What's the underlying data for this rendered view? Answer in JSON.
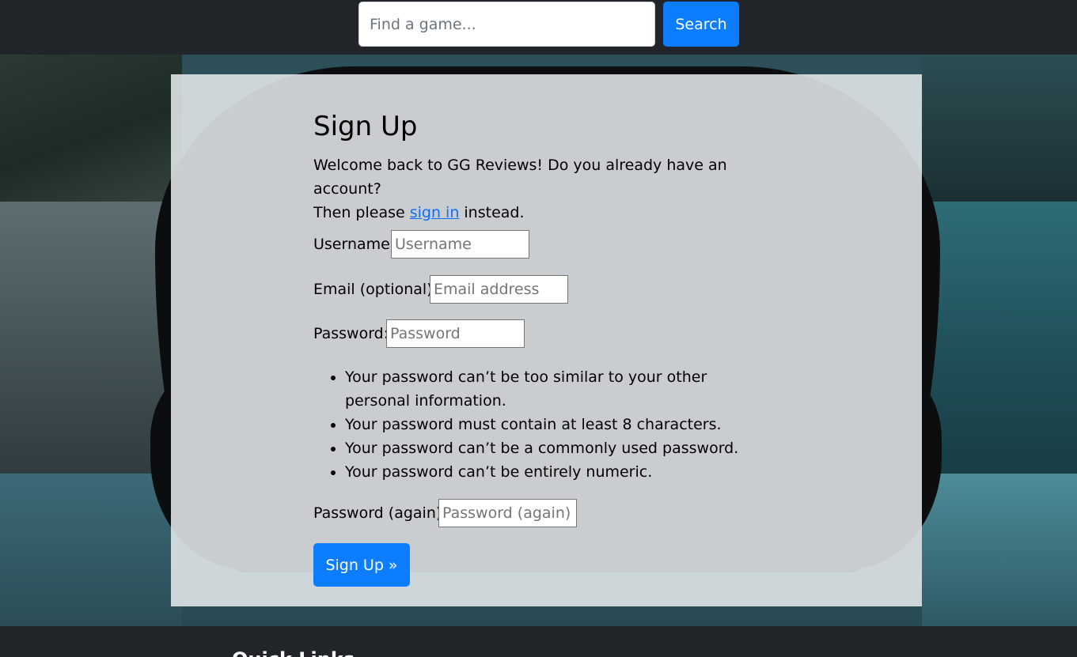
{
  "navbar": {
    "search_placeholder": "Find a game...",
    "search_button_label": "Search"
  },
  "signup": {
    "title": "Sign Up",
    "intro_line1": "Welcome back to GG Reviews! Do you already have an account?",
    "intro_then": "Then please ",
    "intro_link": "sign in",
    "intro_after": " instead.",
    "username_label": "Username:",
    "username_placeholder": "Username",
    "email_label": "Email (optional):",
    "email_placeholder": "Email address",
    "password_label": "Password:",
    "password_placeholder": "Password",
    "password_rules": [
      "Your password can’t be too similar to your other personal information.",
      "Your password must contain at least 8 characters.",
      "Your password can’t be a commonly used password.",
      "Your password can’t be entirely numeric."
    ],
    "password2_label": "Password (again):",
    "password2_placeholder": "Password (again)",
    "submit_label": "Sign Up »"
  },
  "footer": {
    "heading": "Quick Links"
  },
  "colors": {
    "primary": "#0d7dff",
    "navbar": "#212529",
    "link": "#0d6efd"
  }
}
